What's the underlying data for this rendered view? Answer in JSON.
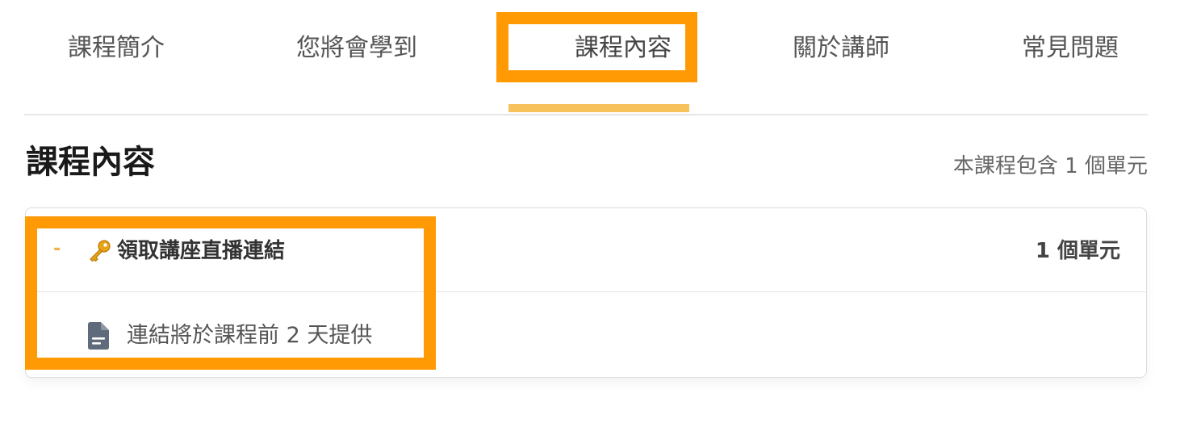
{
  "tabs": [
    {
      "label": "課程簡介"
    },
    {
      "label": "您將會學到"
    },
    {
      "label": "課程內容"
    },
    {
      "label": "關於講師"
    },
    {
      "label": "常見問題"
    }
  ],
  "active_tab": "課程內容",
  "section": {
    "title": "課程內容",
    "unit_summary": "本課程包含 1 個單元"
  },
  "chapter": {
    "collapse_symbol": "-",
    "icon": "key-icon",
    "title": "領取講座直播連結",
    "unit_count": "1 個單元",
    "lessons": [
      {
        "icon": "document-icon",
        "title": "連結將於課程前 2 天提供"
      }
    ]
  },
  "colors": {
    "highlight": "#ff9a05",
    "tab_underline": "#f7c15c",
    "collapse_accent": "#f0b04a",
    "border": "#dddddd"
  }
}
